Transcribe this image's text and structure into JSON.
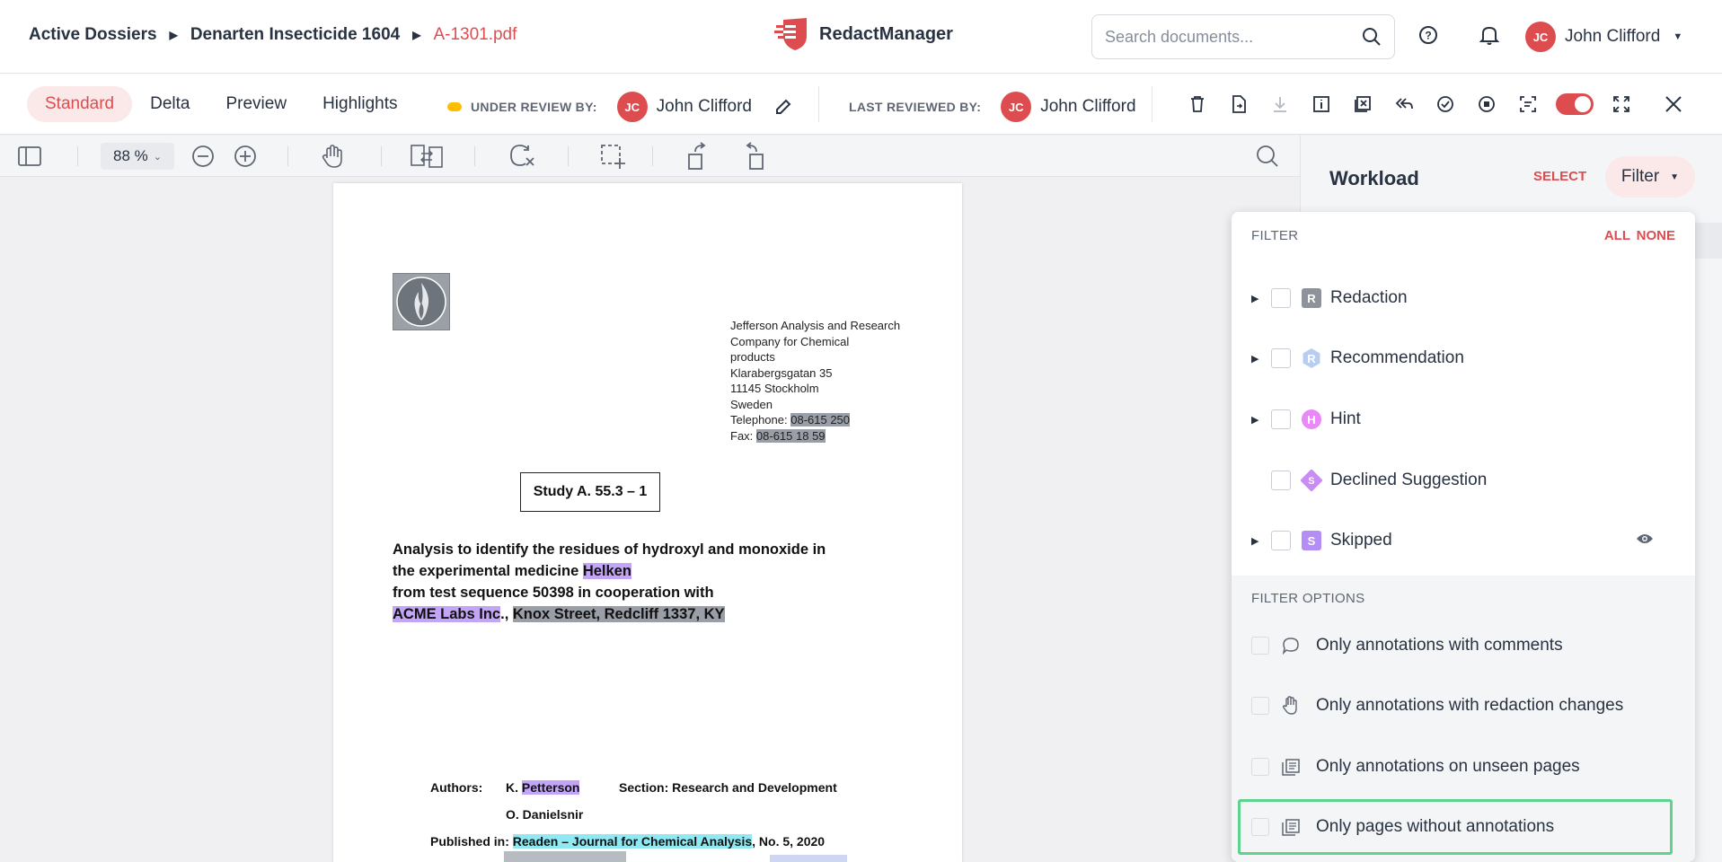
{
  "breadcrumb": [
    "Active Dossiers",
    "Denarten Insecticide 1604",
    "A-1301.pdf"
  ],
  "app_name": "RedactManager",
  "search": {
    "placeholder": "Search documents..."
  },
  "user": {
    "initials": "JC",
    "name": "John Clifford"
  },
  "view_tabs": [
    "Standard",
    "Delta",
    "Preview",
    "Highlights"
  ],
  "active_tab": "Standard",
  "review": {
    "under_label": "UNDER REVIEW BY:",
    "under_name": "John Clifford",
    "last_label": "LAST REVIEWED BY:",
    "last_name": "John Clifford"
  },
  "viewer": {
    "zoom": "88 %"
  },
  "document": {
    "address_lines": [
      "Jefferson Analysis and Research",
      "Company for Chemical",
      "products",
      "Klarabergsgatan 35",
      "11145 Stockholm",
      "Sweden"
    ],
    "telephone_label": "Telephone: ",
    "telephone": "08-615 250",
    "fax_label": "Fax: ",
    "fax": "08-615 18 59",
    "study": "Study A. 55.3 – 1",
    "heading_1": "Analysis to identify the residues of hydroxyl and monoxide in",
    "heading_2a": "the experimental medicine ",
    "heading_2b": "Helken",
    "heading_3": "from test sequence 50398 in cooperation with",
    "heading_4a": "ACME Labs Inc",
    "heading_4b": ".,",
    "heading_4c": "Knox Street, Redcliff 1337, KY",
    "authors_label": "Authors:",
    "author1_prefix": "K. ",
    "author1": "Petterson",
    "section": "Section: Research and Development",
    "author2": "O. Danielsnir",
    "published_label": "Published in: ",
    "published": "Readen – Journal for Chemical Analysis",
    "published_suffix": ", No. 5, 2020"
  },
  "workload": {
    "title": "Workload",
    "select": "SELECT",
    "filter": "Filter"
  },
  "filter_menu": {
    "header": "FILTER",
    "all": "ALL",
    "none": "NONE",
    "items": [
      {
        "label": "Redaction",
        "badge": "R"
      },
      {
        "label": "Recommendation",
        "badge": "R"
      },
      {
        "label": "Hint",
        "badge": "H"
      },
      {
        "label": "Declined Suggestion",
        "badge": "S"
      },
      {
        "label": "Skipped",
        "badge": "S"
      }
    ],
    "options_header": "FILTER OPTIONS",
    "options": [
      "Only annotations with comments",
      "Only annotations with redaction changes",
      "Only annotations on unseen pages",
      "Only pages without annotations"
    ]
  },
  "colors": {
    "accent": "#dd4d50",
    "highlight_box": "#5fd38e"
  }
}
